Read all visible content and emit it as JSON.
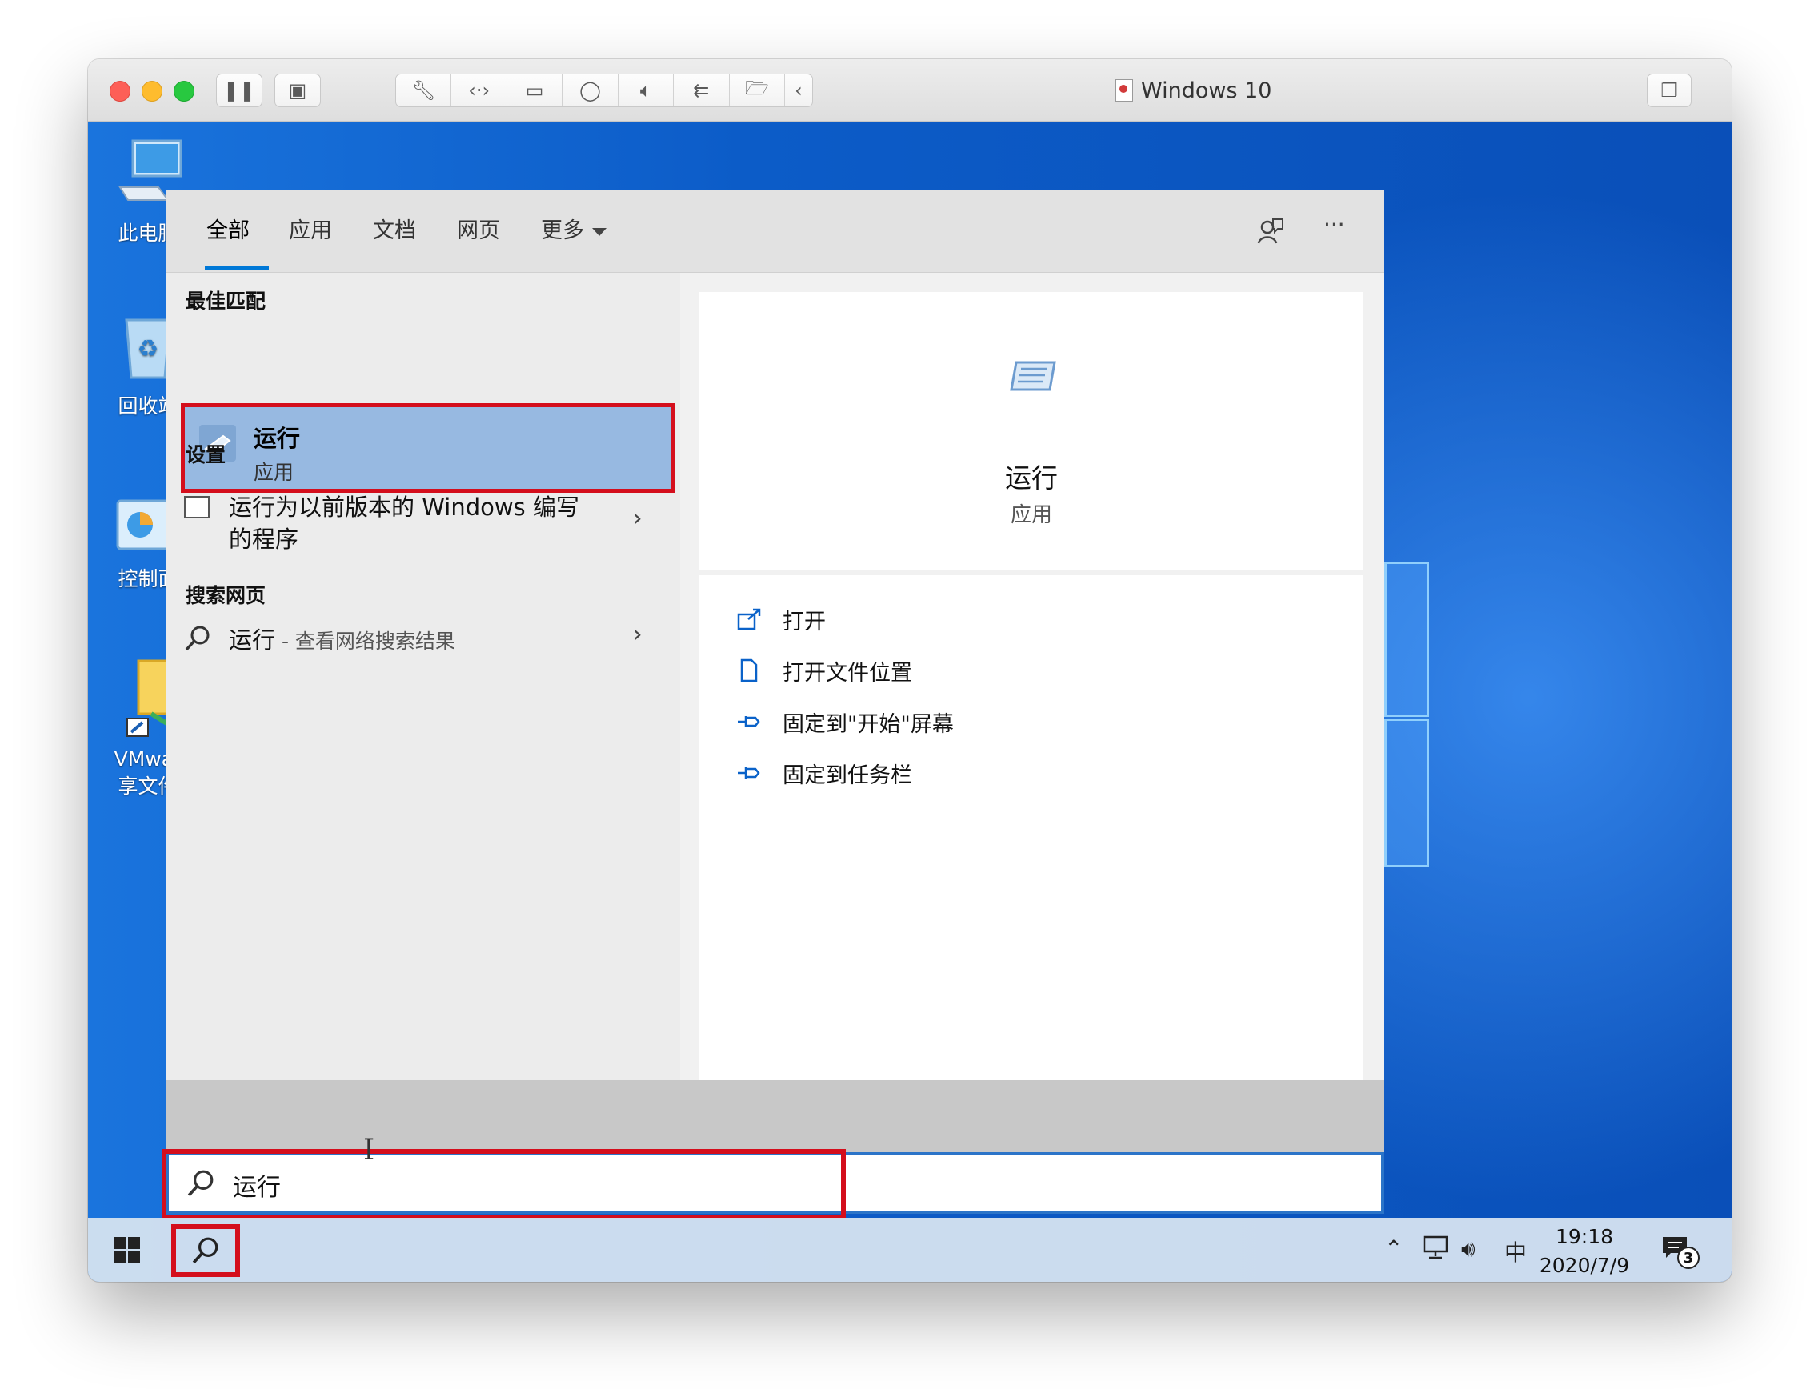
{
  "window": {
    "title": "Windows 10",
    "buttons": [
      "pause-icon",
      "snapshot-icon",
      "wrench-icon",
      "code-icon",
      "disk-icon",
      "camera-icon",
      "speaker-icon",
      "usb-icon",
      "shared-folder-icon",
      "chevron-left-icon",
      "restore-window-icon"
    ]
  },
  "desktop": {
    "icons": [
      {
        "label": "此电脑"
      },
      {
        "label": "回收站"
      },
      {
        "label": "控制面"
      },
      {
        "label": "VMwar",
        "label2": "享文件"
      }
    ]
  },
  "search_panel": {
    "tabs": [
      {
        "label": "全部",
        "active": true
      },
      {
        "label": "应用"
      },
      {
        "label": "文档"
      },
      {
        "label": "网页"
      },
      {
        "label": "更多"
      }
    ],
    "best_match": {
      "heading": "最佳匹配",
      "title": "运行",
      "subtitle": "应用"
    },
    "settings": {
      "heading": "设置",
      "item": "运行为以前版本的 Windows 编写的程序"
    },
    "web": {
      "heading": "搜索网页",
      "term": "运行",
      "hint": " - 查看网络搜索结果"
    },
    "detail": {
      "title": "运行",
      "subtitle": "应用",
      "actions": [
        {
          "label": "打开",
          "icon": "open-icon"
        },
        {
          "label": "打开文件位置",
          "icon": "file-location-icon"
        },
        {
          "label": "固定到\"开始\"屏幕",
          "icon": "pin-icon"
        },
        {
          "label": "固定到任务栏",
          "icon": "pin-icon"
        }
      ]
    }
  },
  "search_box": {
    "value": "运行"
  },
  "taskbar": {
    "ime": "中",
    "time": "19:18",
    "date": "2020/7/9",
    "notification_count": "3"
  },
  "colors": {
    "highlight_red": "#d40e1c",
    "selection_blue": "#97b9e1",
    "accent": "#0078d7"
  }
}
